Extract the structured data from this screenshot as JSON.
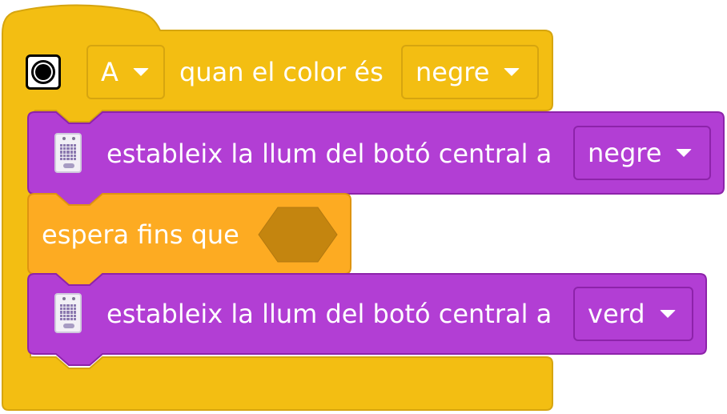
{
  "colors": {
    "event_yellow": "#f3be12",
    "light_purple": "#b23ed4",
    "control_orange": "#fdab22",
    "boolean_slot": "#c4850f"
  },
  "hat_block": {
    "icon": "color-sensor-icon",
    "port_dropdown": "A",
    "label": "quan el color és",
    "color_dropdown": "negre"
  },
  "blocks": [
    {
      "icon": "hub-icon",
      "label": "estableix la llum del botó central a",
      "value": "negre"
    },
    {
      "label": "espera fins que"
    },
    {
      "icon": "hub-icon",
      "label": "estableix la llum del botó central a",
      "value": "verd"
    }
  ]
}
